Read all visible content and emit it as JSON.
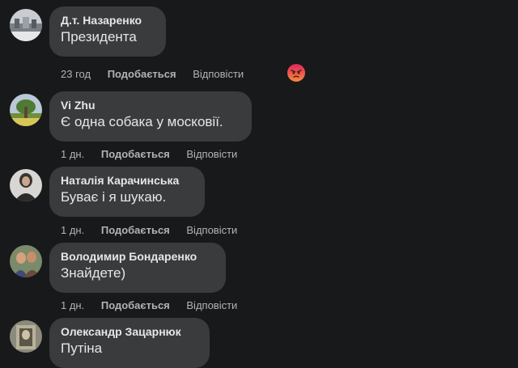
{
  "comments": [
    {
      "author": "Д.т. Назаренко",
      "text": "Президента",
      "time": "23 год",
      "like_label": "Подобається",
      "reply_label": "Відповісти",
      "reaction_icon": "angry-reaction-icon"
    },
    {
      "author": "Vi Zhu",
      "text": "Є одна собака у московії.",
      "time": "1 дн.",
      "like_label": "Подобається",
      "reply_label": "Відповісти"
    },
    {
      "author": "Наталія Карачинська",
      "text": "Буває і я шукаю.",
      "time": "1 дн.",
      "like_label": "Подобається",
      "reply_label": "Відповісти"
    },
    {
      "author": "Володимир Бондаренко",
      "text": "Знайдете)",
      "time": "1 дн.",
      "like_label": "Подобається",
      "reply_label": "Відповісти"
    },
    {
      "author": "Олександр Зацарнюк",
      "text": "Путіна",
      "time": "",
      "like_label": "",
      "reply_label": ""
    }
  ],
  "colors": {
    "background": "#18191a",
    "bubble": "#3a3b3c",
    "primary_text": "#e4e6eb",
    "secondary_text": "#b0b3b8",
    "angry_reaction": "#f0543d"
  }
}
